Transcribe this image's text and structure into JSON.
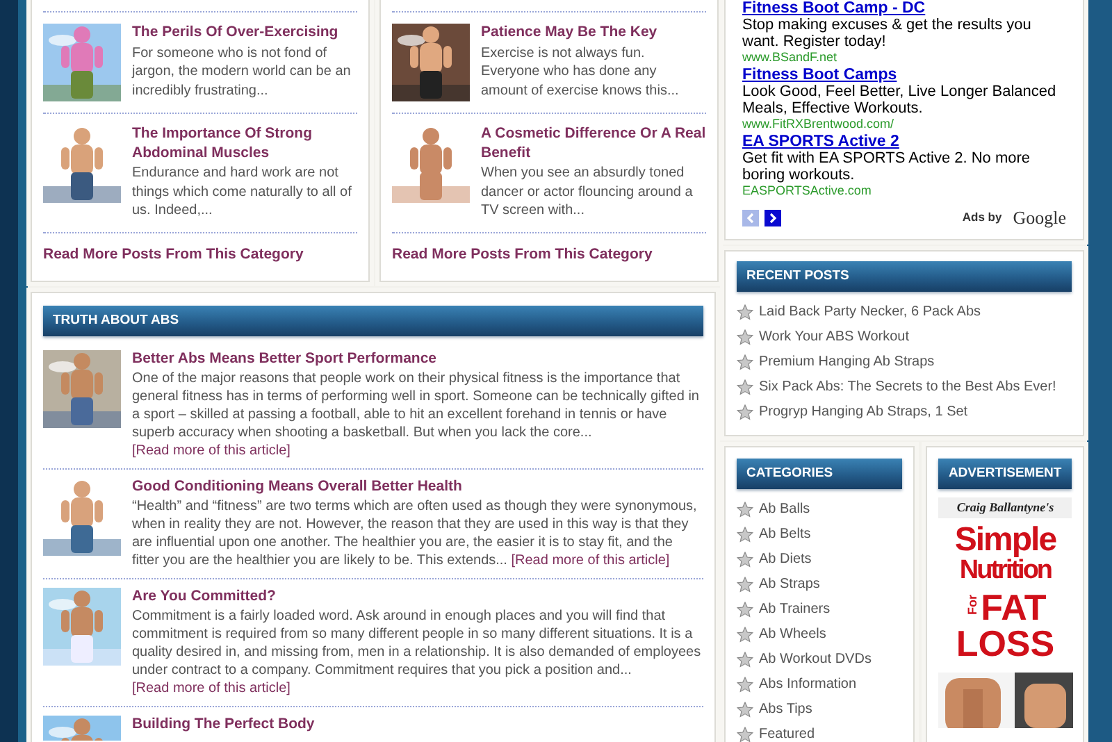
{
  "top_columns": [
    {
      "posts": [
        {
          "title": "The Perils Of Over-Exercising",
          "excerpt": "For someone who is not fond of jargon, the modern world can be an incredibly frustrating..."
        },
        {
          "title": "The Importance Of Strong Abdominal Muscles",
          "excerpt": "Endurance and hard work are not things which come naturally to all of us. Indeed,..."
        }
      ],
      "more_link": "Read More Posts From This Category"
    },
    {
      "posts": [
        {
          "title": "Patience May Be The Key",
          "excerpt": "Exercise is not always fun. Everyone who has done any amount of exercise knows this..."
        },
        {
          "title": "A Cosmetic Difference Or A Real Benefit",
          "excerpt": "When you see an absurdly toned dancer or actor flouncing around a TV screen with..."
        }
      ],
      "more_link": "Read More Posts From This Category"
    }
  ],
  "section": {
    "title": "TRUTH ABOUT ABS",
    "posts": [
      {
        "title": "Better Abs Means Better Sport Performance",
        "excerpt": "One of the major reasons that people work on their physical fitness is the importance that general fitness has in terms of performing well in sport. Someone can be technically gifted in a sport – skilled at passing a football, able to hit an excellent forehand in tennis or have superb accuracy when shooting a basketball. But when you lack the core...",
        "more": "[Read more of this article]"
      },
      {
        "title": "Good Conditioning Means Overall Better Health",
        "excerpt": "“Health” and “fitness” are two terms which are often used as though they were synonymous, when in reality they are not. However, the reason that they are used in this way is that they are influential upon one another. The healthier you are, the easier it is to stay fit, and the fitter you are the healthier you are likely to be. This extends...",
        "more": "[Read more of this article]"
      },
      {
        "title": "Are You Committed?",
        "excerpt": "Commitment is a fairly loaded word. Ask around in enough places and you will find that commitment is required from so many different people in so many different situations. It is a quality desired in, and missing from, men in a relationship. It is also demanded of employees under contract to a company. Commitment requires that you pick a position and...",
        "more": "[Read more of this article]"
      },
      {
        "title": "Building The Perfect Body"
      }
    ]
  },
  "ads": {
    "items": [
      {
        "title": "Fitness Boot Camp - DC",
        "text": "Stop making excuses & get the results you want. Register today!",
        "url": "www.BSandF.net"
      },
      {
        "title": "Fitness Boot Camps",
        "text": "Look Good, Feel Better, Live Longer Balanced Meals, Effective Workouts.",
        "url": "www.FitRXBrentwood.com/"
      },
      {
        "title": "EA SPORTS Active 2",
        "text": "Get fit with EA SPORTS Active 2. No more boring workouts.",
        "url": "EASPORTSActive.com"
      }
    ],
    "prev_disabled": true,
    "label": "Ads by",
    "brand": "Google"
  },
  "recent_posts": {
    "title": "RECENT POSTS",
    "items": [
      "Laid Back Party Necker, 6 Pack Abs",
      "Work Your ABS Workout",
      "Premium Hanging Ab Straps",
      "Six Pack Abs: The Secrets to the Best Abs Ever!",
      "Progryp Hanging Ab Straps, 1 Set"
    ]
  },
  "categories": {
    "title": "CATEGORIES",
    "items": [
      "Ab Balls",
      "Ab Belts",
      "Ab Diets",
      "Ab Straps",
      "Ab Trainers",
      "Ab Wheels",
      "Ab Workout DVDs",
      "Abs Information",
      "Abs Tips",
      "Featured"
    ]
  },
  "advertisement": {
    "title": "ADVERTISEMENT",
    "banner": {
      "author": "Craig Ballantyne's",
      "line1": "Simple",
      "line2": "Nutrition",
      "for": "For",
      "line3": "FAT",
      "line4": "LOSS"
    }
  }
}
